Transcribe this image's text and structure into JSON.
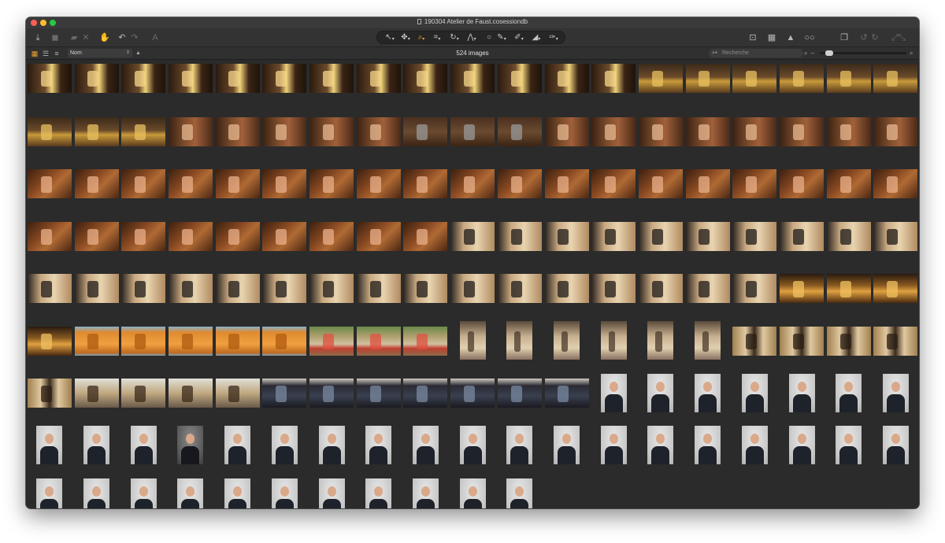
{
  "window": {
    "title": "190304 Atelier de Faust.cosessiondb"
  },
  "toolbar": {
    "left_icons": [
      "import-icon",
      "camera-icon",
      "folder-icon",
      "delete-icon",
      "hand-icon",
      "undo-icon",
      "redo-icon",
      "text-icon"
    ],
    "tools": [
      "select-icon",
      "pan-icon",
      "zoom-icon",
      "crop-icon",
      "rotate-icon",
      "keystone-icon",
      "spot-icon",
      "picker-icon",
      "brush-icon",
      "eraser-icon",
      "mask-icon"
    ],
    "right_icons": [
      "edit-icon",
      "grid-view-icon",
      "warning-icon",
      "glasses-icon",
      "stack-icon",
      "rotate-left-icon",
      "rotate-right-icon",
      "expand-icon"
    ]
  },
  "browser": {
    "sort_label": "Nom",
    "count_label": "524 images",
    "search_placeholder": "Recherche",
    "zoom_level": 0.05
  },
  "thumbnails": {
    "rows": [
      [
        "warm-closeup",
        "warm-closeup",
        "warm-closeup",
        "warm-closeup",
        "warm-closeup",
        "warm-closeup",
        "warm-closeup",
        "warm-closeup",
        "warm-closeup",
        "warm-closeup",
        "warm-closeup",
        "warm-closeup",
        "warm-closeup",
        "gold-tray",
        "gold-tray",
        "gold-tray",
        "gold-tray",
        "gold-tray",
        "gold-tray"
      ],
      [
        "gold-tray",
        "gold-tray",
        "gold-tray",
        "workbench-man",
        "workbench-man",
        "workbench-man",
        "workbench-man",
        "workbench-man",
        "tools-box",
        "tools-box",
        "tools-box",
        "workbench-man",
        "workbench-man",
        "workbench-man",
        "workbench-man",
        "workbench-man",
        "workbench-man",
        "workbench-man",
        "workbench-man"
      ],
      [
        "drawer-hands",
        "drawer-hands",
        "drawer-hands",
        "drawer-hands",
        "drawer-hands",
        "drawer-hands",
        "drawer-hands",
        "drawer-hands",
        "drawer-hands",
        "drawer-hands",
        "drawer-hands",
        "drawer-hands",
        "drawer-hands",
        "drawer-hands",
        "drawer-hands",
        "drawer-hands",
        "drawer-hands",
        "drawer-hands",
        "drawer-hands"
      ],
      [
        "drawer-hands",
        "drawer-hands",
        "drawer-hands",
        "drawer-hands",
        "drawer-hands",
        "drawer-hands",
        "drawer-hands",
        "drawer-hands",
        "drawer-hands",
        "man-frames",
        "man-frames",
        "man-frames",
        "man-frames",
        "man-frames",
        "man-frames",
        "man-frames",
        "man-frames",
        "man-frames",
        "man-frames"
      ],
      [
        "man-frames",
        "man-frames",
        "man-frames",
        "man-frames",
        "man-frames",
        "man-frames",
        "man-frames",
        "man-frames",
        "man-frames",
        "man-frames",
        "man-frames",
        "man-frames",
        "man-frames",
        "man-frames",
        "man-frames",
        "man-frames",
        "gold-box",
        "gold-box",
        "gold-box"
      ],
      [
        "gold-box",
        "orange-mat",
        "orange-mat",
        "orange-mat",
        "orange-mat",
        "orange-mat",
        "shopfront-flowers",
        "shopfront-flowers",
        "shopfront-flowers",
        "portrait-wall",
        "portrait-wall",
        "portrait-wall",
        "portrait-wall",
        "portrait-wall",
        "portrait-wall",
        "shelves",
        "shelves",
        "shelves",
        "shelves"
      ],
      [
        "shelves",
        "frames-table",
        "frames-table",
        "frames-table",
        "frames-table",
        "shopfront-dark",
        "shopfront-dark",
        "shopfront-dark",
        "shopfront-dark",
        "shopfront-dark",
        "shopfront-dark",
        "shopfront-dark",
        "portrait-man",
        "portrait-man",
        "portrait-man",
        "portrait-man",
        "portrait-man",
        "portrait-man",
        "portrait-man"
      ],
      [
        "portrait-man",
        "portrait-man",
        "portrait-man",
        "portrait-man-dark",
        "portrait-man",
        "portrait-man",
        "portrait-man",
        "portrait-man",
        "portrait-man",
        "portrait-man",
        "portrait-man",
        "portrait-man",
        "portrait-man",
        "portrait-man",
        "portrait-man",
        "portrait-man",
        "portrait-man",
        "portrait-man",
        "portrait-man"
      ],
      [
        "portrait-man",
        "portrait-man",
        "portrait-man",
        "portrait-man",
        "portrait-man",
        "portrait-man",
        "portrait-man",
        "portrait-man",
        "portrait-man",
        "portrait-man",
        "portrait-man"
      ]
    ]
  },
  "colors": {
    "window_bg": "#2b2b2b",
    "accent": "#f0a030"
  }
}
